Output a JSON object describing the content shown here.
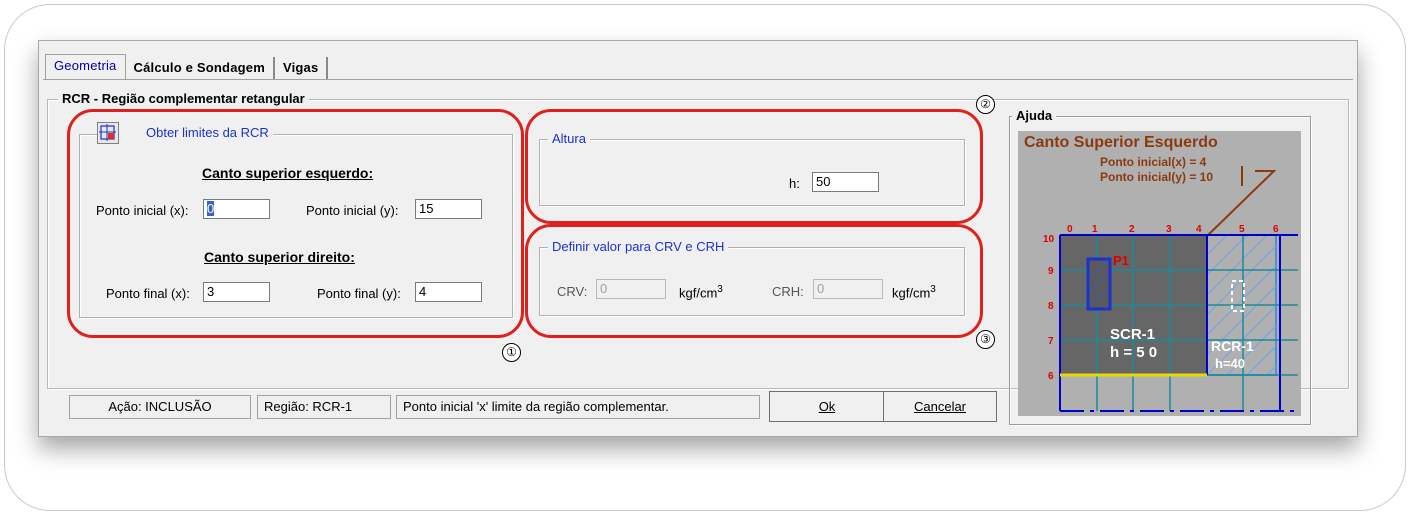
{
  "tabs": [
    "Geometria",
    "Cálculo e Sondagem",
    "Vigas"
  ],
  "main_group": "RCR - Região complementar retangular",
  "limits": {
    "button_label": "Obter limites da RCR",
    "top_left_header": "Canto superior esquerdo:",
    "x0_label": "Ponto inicial (x):",
    "x0_value": "0",
    "y0_label": "Ponto inicial (y):",
    "y0_value": "15",
    "top_right_header": "Canto superior direito:",
    "x1_label": "Ponto final (x):",
    "x1_value": "3",
    "y1_label": "Ponto final (y):",
    "y1_value": "4"
  },
  "altura": {
    "title": "Altura",
    "h_label": "h:",
    "h_value": "50"
  },
  "crv_crh": {
    "title": "Definir valor para CRV e CRH",
    "crv_label": "CRV:",
    "crv_value": "0",
    "crv_unit": "kgf/cm",
    "crh_label": "CRH:",
    "crh_value": "0",
    "crh_unit": "kgf/cm",
    "exp": "3"
  },
  "markers": [
    "①",
    "②",
    "③"
  ],
  "status": {
    "acao": "Ação: INCLUSÃO",
    "regiao": "Região: RCR-1",
    "msg": "Ponto inicial 'x' limite da região complementar."
  },
  "buttons": {
    "ok": "Ok",
    "cancel": "Cancelar"
  },
  "help": {
    "title": "Ajuda",
    "heading": "Canto Superior Esquerdo",
    "line1": "Ponto inicial(x) = 4",
    "line2": "Ponto inicial(y) = 10",
    "top_ticks": [
      "0",
      "1",
      "2",
      "3",
      "4",
      "5",
      "6"
    ],
    "left_ticks": [
      "10",
      "9",
      "8",
      "7",
      "6"
    ],
    "p1": "P1",
    "scr": "SCR-1",
    "scr_h": "h = 5 0",
    "rcr": "RCR-1",
    "rcr_h": "h=40",
    "colors": {
      "bg": "#b0b0b0",
      "heading": "#8b3a10",
      "grid": "#1a8a9a",
      "axis": "#0000cc",
      "tick": "#dd0000",
      "block": "#666666",
      "hatch": "#4f8fd6",
      "base": "#e8d800"
    }
  }
}
